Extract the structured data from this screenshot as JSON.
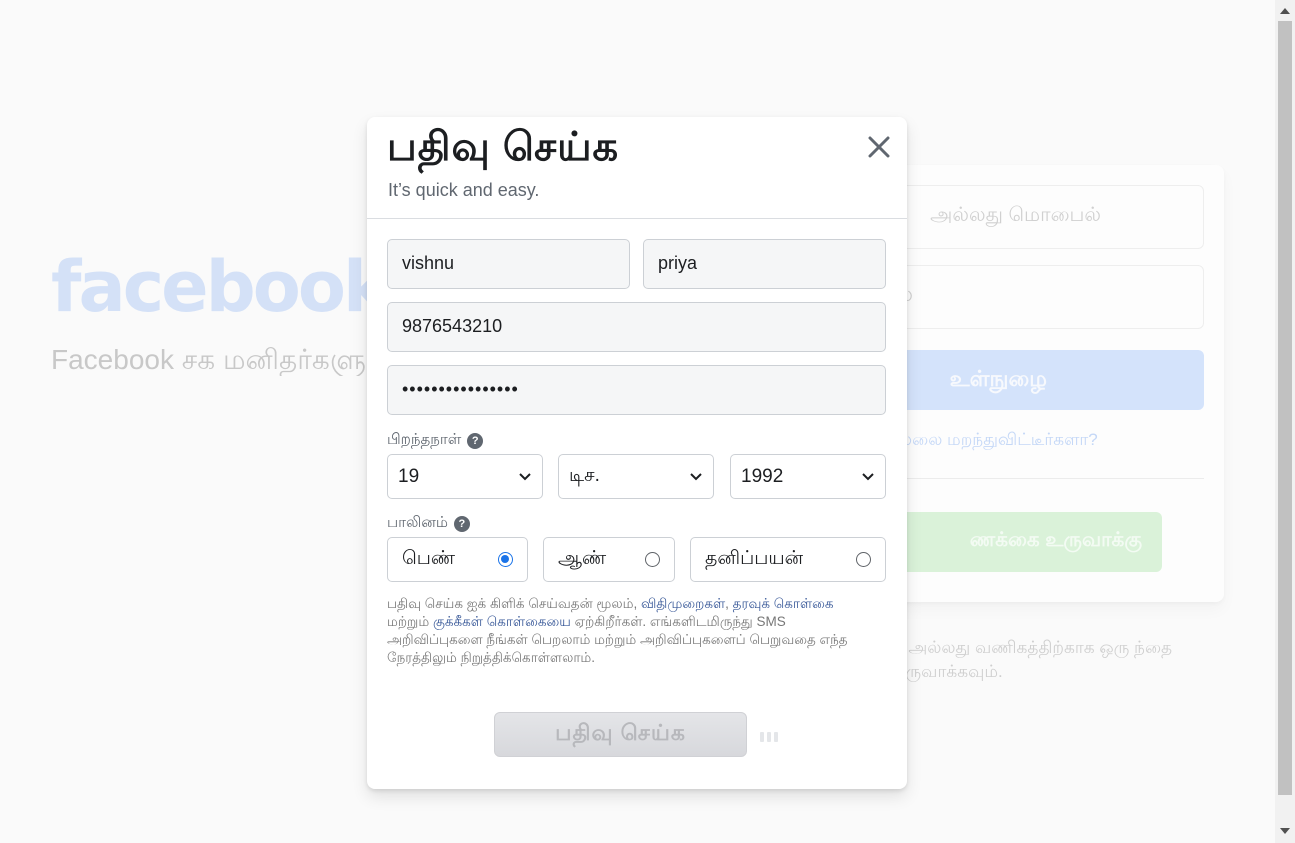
{
  "background": {
    "logo": "facebook",
    "tagline": "Facebook சக மனிதர்களுடன் தொடர்புகொள்ளவும் உறவாட உதவுகிறது.",
    "login_email_placeholder": "அல்லது மொபைல்",
    "login_password_placeholder": "ல்",
    "login_button": "உள்நுழை",
    "forgot_link": "ல்லை மறந்துவிட்டீர்களா?",
    "create_button": "ணக்கை உருவாக்கு",
    "page_note": "ழ அல்லது வணிகத்திற்காக ஒரு ந்தை உருவாக்கவும்."
  },
  "modal": {
    "title": "பதிவு செய்க",
    "subtitle": "It’s quick and easy.",
    "first_name": "vishnu",
    "last_name": "priya",
    "mobile": "9876543210",
    "password_masked": "••••••••••••••••",
    "dob_label": "பிறந்தநாள்",
    "dob_day": "19",
    "dob_month": "டிச.",
    "dob_year": "1992",
    "gender_label": "பாலினம்",
    "gender_female": "பெண்",
    "gender_male": "ஆண்",
    "gender_custom": "தனிப்பயன்",
    "selected_gender": "female",
    "terms_prefix": "பதிவு செய்க ஐக் கிளிக் செய்வதன் மூலம், ",
    "terms_link": "விதிமுறைகள்",
    "terms_sep": ", ",
    "data_policy_link": "தரவுக் கொள்கை",
    "terms_mid": " மற்றும் ",
    "cookie_link": "குக்கீகள் கொள்கையை",
    "terms_suffix": " ஏற்கிறீர்கள். எங்களிடமிருந்து SMS அறிவிப்புகளை நீங்கள் பெறலாம் மற்றும் அறிவிப்புகளைப் பெறுவதை எந்த நேரத்திலும் நிறுத்திக்கொள்ளலாம்.",
    "signup_button": "பதிவு செய்க"
  },
  "colors": {
    "accent": "#1a73e8",
    "link": "#385898"
  }
}
